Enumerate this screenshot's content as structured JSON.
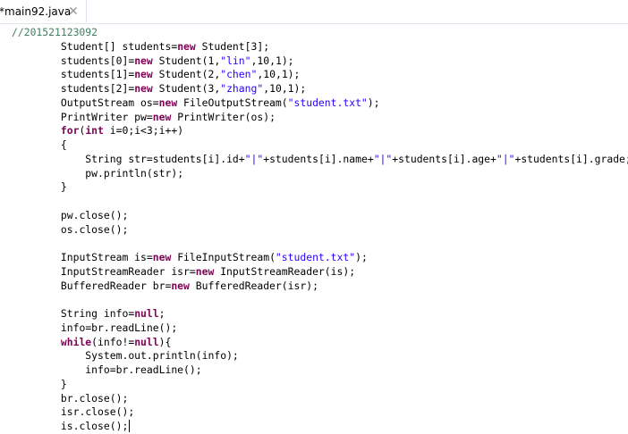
{
  "tab": {
    "label": "*main92.java",
    "close_icon": "close-icon"
  },
  "editor": {
    "lines": [
      "//201521123092",
      "        Student[] students=new Student[3];",
      "        students[0]=new Student(1,\"lin\",10,1);",
      "        students[1]=new Student(2,\"chen\",10,1);",
      "        students[2]=new Student(3,\"zhang\",10,1);",
      "        OutputStream os=new FileOutputStream(\"student.txt\");",
      "        PrintWriter pw=new PrintWriter(os);",
      "        for(int i=0;i<3;i++)",
      "        {",
      "            String str=students[i].id+\"|\"+students[i].name+\"|\"+students[i].age+\"|\"+students[i].grade;",
      "            pw.println(str);",
      "        }",
      "",
      "        pw.close();",
      "        os.close();",
      "",
      "        InputStream is=new FileInputStream(\"student.txt\");",
      "        InputStreamReader isr=new InputStreamReader(is);",
      "        BufferedReader br=new BufferedReader(isr);",
      "",
      "        String info=null;",
      "        info=br.readLine();",
      "        while(info!=null){",
      "            System.out.println(info);",
      "            info=br.readLine();",
      "        }",
      "        br.close();",
      "        isr.close();",
      "        is.close();"
    ],
    "colors": {
      "keyword": "#7f0055",
      "string": "#2a00ff",
      "comment": "#3f7f5f",
      "text": "#000000"
    }
  }
}
